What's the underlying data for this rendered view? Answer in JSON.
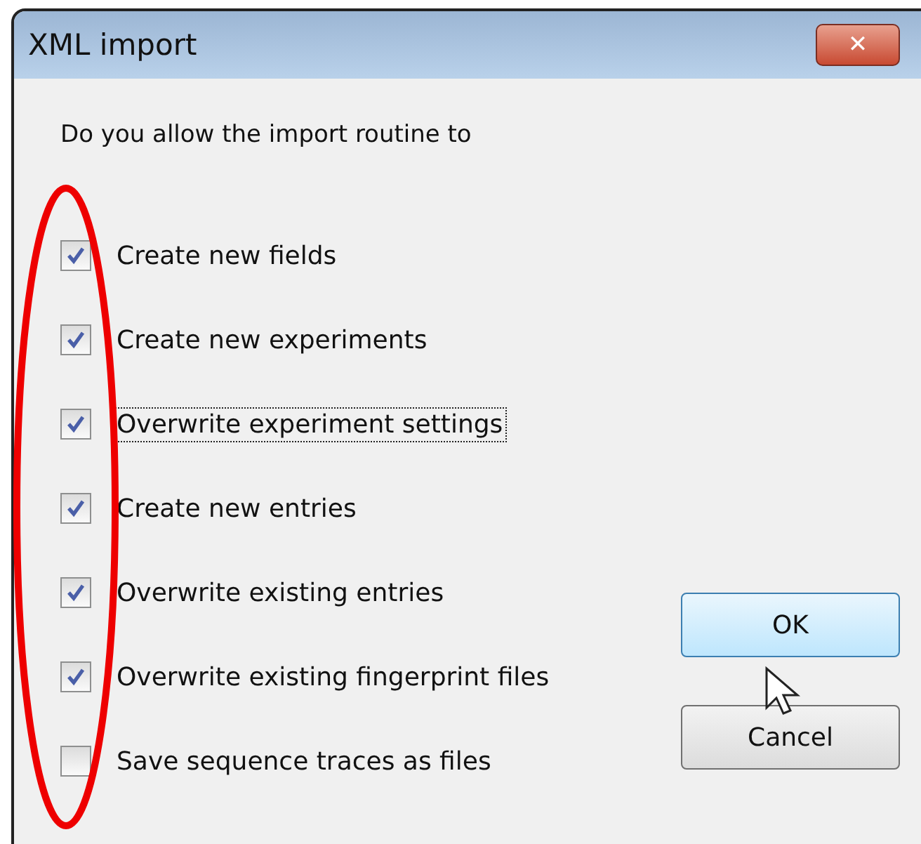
{
  "window": {
    "title": "XML import",
    "close": "✕"
  },
  "prompt": "Do you allow the import routine to",
  "options": [
    {
      "label": "Create new fields",
      "checked": true,
      "focused": false
    },
    {
      "label": "Create new experiments",
      "checked": true,
      "focused": false
    },
    {
      "label": "Overwrite experiment settings",
      "checked": true,
      "focused": true
    },
    {
      "label": "Create new entries",
      "checked": true,
      "focused": false
    },
    {
      "label": "Overwrite existing entries",
      "checked": true,
      "focused": false
    },
    {
      "label": "Overwrite existing fingerprint files",
      "checked": true,
      "focused": false
    },
    {
      "label": "Save sequence traces as files",
      "checked": false,
      "focused": false
    }
  ],
  "buttons": [
    {
      "label": "OK",
      "hovered": true
    },
    {
      "label": "Cancel",
      "hovered": false
    }
  ]
}
